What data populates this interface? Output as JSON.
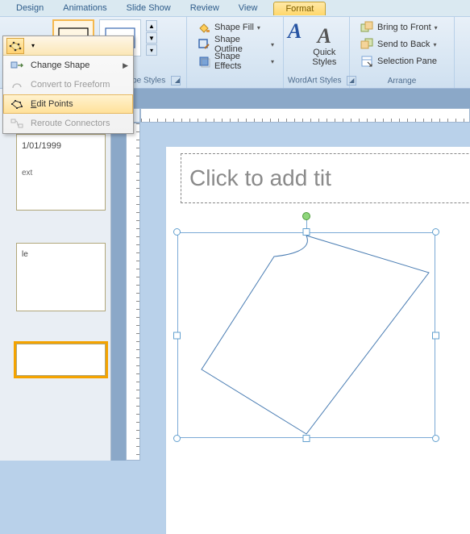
{
  "tabs": {
    "design": "Design",
    "animations": "Animations",
    "slideshow": "Slide Show",
    "review": "Review",
    "view": "View",
    "format": "Format"
  },
  "ribbon": {
    "shape_styles_label": "hape Styles",
    "wordart_label": "WordArt Styles",
    "arrange_label": "Arrange",
    "shape_fill": "Shape Fill",
    "shape_outline": "Shape Outline",
    "shape_effects": "Shape Effects",
    "quick_styles": "Quick\nStyles",
    "bring_front": "Bring to Front",
    "send_back": "Send to Back",
    "selection_pane": "Selection Pane"
  },
  "menu": {
    "change_shape": "Change Shape",
    "convert_freeform": "Convert to Freeform",
    "edit_points": "Edit Points",
    "edit_points_accel": "E",
    "reroute": "Reroute Connectors"
  },
  "panel": {
    "date": "1/01/1999",
    "text_label": "ext",
    "le_label": "le"
  },
  "canvas": {
    "title_placeholder": "Click to add tit"
  },
  "colors": {
    "styleA1": "#2855a3",
    "styleA2": "#000000",
    "styleA3": "#d9d9d9"
  }
}
